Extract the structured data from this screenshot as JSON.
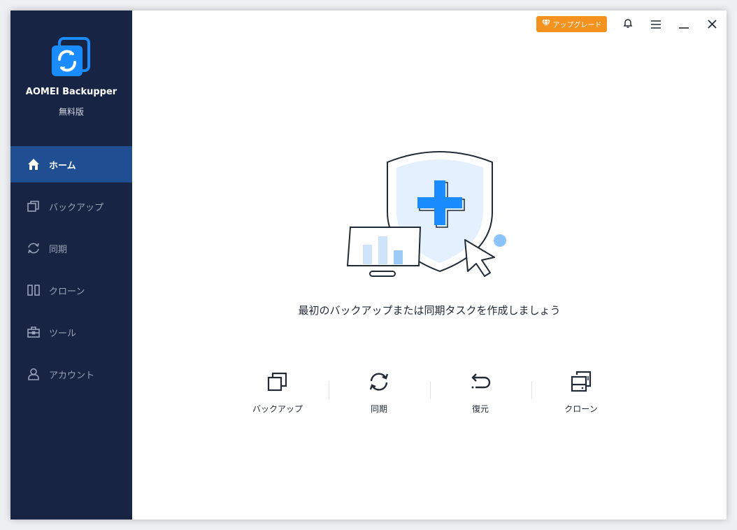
{
  "app": {
    "name": "AOMEI Backupper",
    "edition": "無料版"
  },
  "header": {
    "upgrade_label": "アップグレード"
  },
  "sidebar": {
    "items": [
      {
        "label": "ホーム",
        "icon": "home-icon",
        "active": true
      },
      {
        "label": "バックアップ",
        "icon": "backup-icon",
        "active": false
      },
      {
        "label": "同期",
        "icon": "sync-icon",
        "active": false
      },
      {
        "label": "クローン",
        "icon": "clone-icon",
        "active": false
      },
      {
        "label": "ツール",
        "icon": "toolbox-icon",
        "active": false
      },
      {
        "label": "アカウント",
        "icon": "user-icon",
        "active": false
      }
    ]
  },
  "main": {
    "headline": "最初のバックアップまたは同期タスクを作成しましょう",
    "actions": [
      {
        "label": "バックアップ",
        "icon": "backup-icon"
      },
      {
        "label": "同期",
        "icon": "sync-icon"
      },
      {
        "label": "復元",
        "icon": "restore-icon"
      },
      {
        "label": "クローン",
        "icon": "clone-icon"
      }
    ]
  },
  "colors": {
    "sidebar_bg": "#172444",
    "sidebar_active": "#1f4f92",
    "accent_blue": "#1a8cff",
    "upgrade_orange": "#f3921f"
  }
}
